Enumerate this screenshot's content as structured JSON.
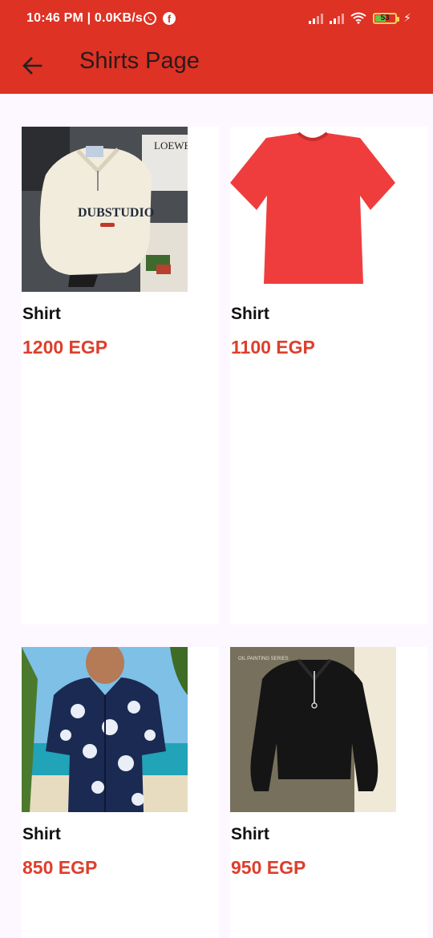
{
  "status_bar": {
    "time_speed": "10:46 PM | 0.0KB/s",
    "battery_level": "53",
    "battery_fraction": 0.53
  },
  "app_bar": {
    "title": "Shirts Page",
    "back_icon": "arrow-back-icon"
  },
  "products": [
    {
      "name": "Shirt",
      "price": "1200 EGP",
      "image": "cream-sweatshirt-photo",
      "image_text": "DUBSTUDIO"
    },
    {
      "name": "Shirt",
      "price": "1100 EGP",
      "image": "red-tshirt-photo"
    },
    {
      "name": "Shirt",
      "price": "850 EGP",
      "image": "floral-shirt-photo"
    },
    {
      "name": "Shirt",
      "price": "950 EGP",
      "image": "black-sweatshirt-photo",
      "image_text": "OIL PAINTING SERIES"
    }
  ],
  "colors": {
    "primary": "#dd3224",
    "price": "#dd3f2c",
    "background": "#fdf7ff",
    "card": "#ffffff"
  }
}
